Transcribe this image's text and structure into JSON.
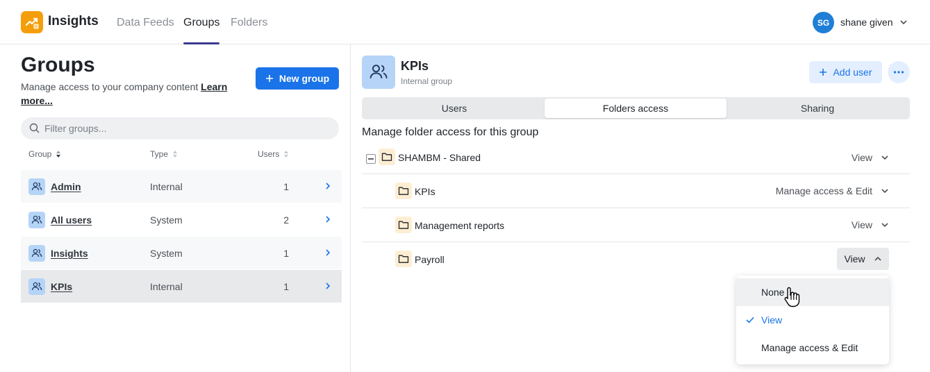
{
  "app": {
    "name": "Insights",
    "accent": "#1a73e8",
    "logo_color": "#f59e0b"
  },
  "nav": {
    "tabs": [
      {
        "label": "Data Feeds",
        "active": false
      },
      {
        "label": "Groups",
        "active": true
      },
      {
        "label": "Folders",
        "active": false
      }
    ]
  },
  "user": {
    "initials": "SG",
    "name": "shane given"
  },
  "groups_page": {
    "title": "Groups",
    "description": "Manage access to your company content",
    "learn_more": "Learn more...",
    "new_group_label": "New group",
    "filter_placeholder": "Filter groups...",
    "columns": {
      "group": "Group",
      "type": "Type",
      "users": "Users"
    },
    "rows": [
      {
        "name": "Admin",
        "type": "Internal",
        "users": "1",
        "selected": false
      },
      {
        "name": "All users",
        "type": "System",
        "users": "2",
        "selected": false
      },
      {
        "name": "Insights",
        "type": "System",
        "users": "1",
        "selected": false
      },
      {
        "name": "KPIs",
        "type": "Internal",
        "users": "1",
        "selected": true
      }
    ]
  },
  "detail": {
    "title": "KPIs",
    "subtitle": "Internal group",
    "add_user_label": "Add user",
    "tabs": [
      {
        "label": "Users",
        "active": false
      },
      {
        "label": "Folders access",
        "active": true
      },
      {
        "label": "Sharing",
        "active": false
      }
    ],
    "heading": "Manage folder access for this group",
    "folders": [
      {
        "name": "SHAMBM - Shared",
        "permission": "View",
        "level": 0
      },
      {
        "name": "KPIs",
        "permission": "Manage access & Edit",
        "level": 1
      },
      {
        "name": "Management reports",
        "permission": "View",
        "level": 1
      },
      {
        "name": "Payroll",
        "permission": "View",
        "level": 1,
        "open": true
      }
    ],
    "dropdown": {
      "options": [
        {
          "label": "None",
          "hovered": true,
          "selected": false
        },
        {
          "label": "View",
          "hovered": false,
          "selected": true
        },
        {
          "label": "Manage access & Edit",
          "hovered": false,
          "selected": false
        }
      ]
    }
  }
}
